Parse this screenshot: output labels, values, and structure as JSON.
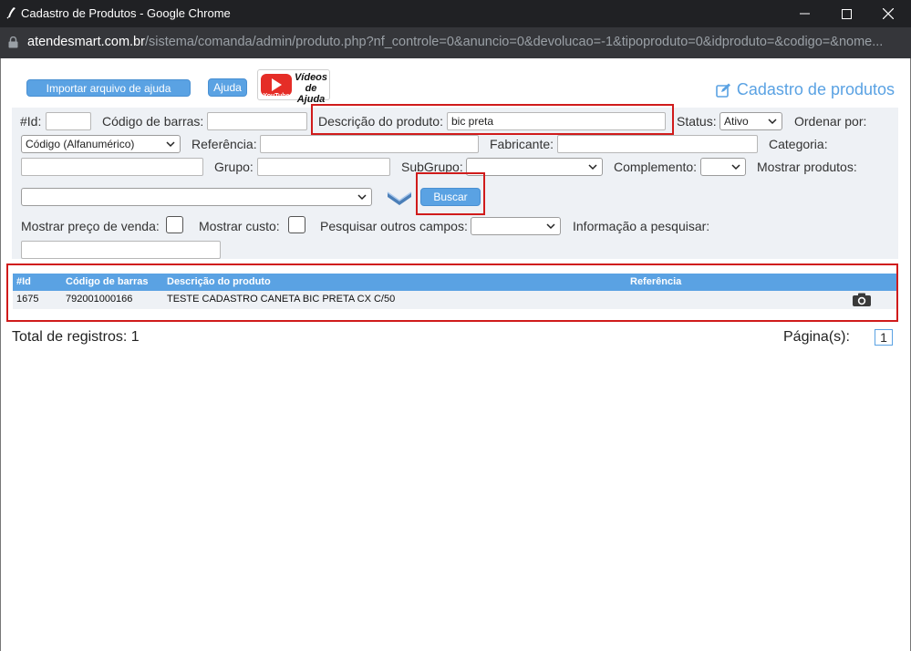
{
  "window": {
    "title": "Cadastro de Produtos - Google Chrome",
    "url_host": "atendesmart.com.br",
    "url_path": "/sistema/comanda/admin/produto.php?nf_controle=0&anuncio=0&devolucao=-1&tipoproduto=0&idproduto=&codigo=&nome..."
  },
  "toolbar": {
    "import_help_label": "Importar arquivo de ajuda",
    "help_label": "Ajuda",
    "videos_label_line1": "Vídeos",
    "videos_label_line2": "de Ajuda",
    "youtube_label": "YouTube"
  },
  "page_title": "Cadastro de produtos",
  "filters": {
    "id_label": "#Id:",
    "id_value": "",
    "barcode_label": "Código de barras:",
    "barcode_value": "",
    "description_label": "Descrição do produto:",
    "description_value": "bic preta",
    "status_label": "Status:",
    "status_value": "Ativo",
    "order_label": "Ordenar por:",
    "order_value": "Código (Alfanumérico)",
    "reference_label": "Referência:",
    "reference_value": "",
    "manufacturer_label": "Fabricante:",
    "manufacturer_value": "",
    "category_label": "Categoria:",
    "category_value": "",
    "group_label": "Grupo:",
    "group_value": "",
    "subgroup_label": "SubGrupo:",
    "subgroup_value": "",
    "complement_label": "Complemento:",
    "complement_value": "",
    "show_products_label": "Mostrar produtos:",
    "show_products_value": "",
    "search_button": "Buscar",
    "show_sale_price_label": "Mostrar preço de venda:",
    "show_cost_label": "Mostrar custo:",
    "search_other_fields_label": "Pesquisar outros campos:",
    "search_other_fields_value": "",
    "info_to_search_label": "Informação a pesquisar:",
    "info_to_search_value": ""
  },
  "table": {
    "headers": [
      "#Id",
      "Código de barras",
      "Descrição do produto",
      "Referência"
    ],
    "rows": [
      {
        "id": "1675",
        "barcode": "792001000166",
        "description": "TESTE CADASTRO CANETA BIC PRETA CX C/50",
        "reference": ""
      }
    ]
  },
  "footer": {
    "total_label": "Total de registros: 1",
    "pages_label": "Página(s):",
    "current_page": "1"
  },
  "colors": {
    "accent": "#5aa2e3",
    "highlight_box": "#d01b1b",
    "panel_bg": "#eef1f5"
  }
}
